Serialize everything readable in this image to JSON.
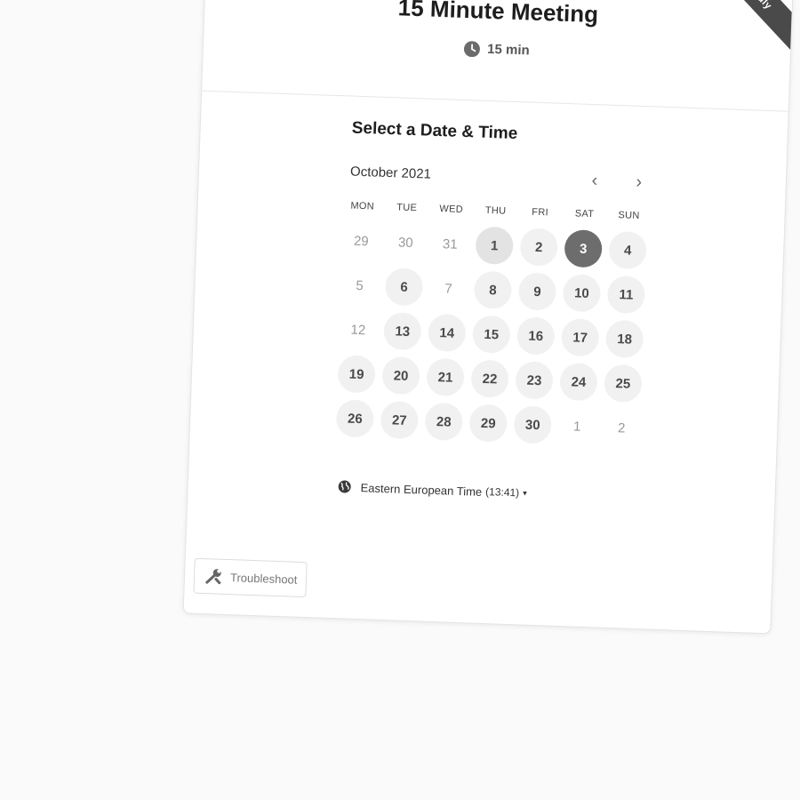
{
  "ribbon": {
    "text": "dly"
  },
  "header": {
    "title": "15 Minute Meeting",
    "duration": "15 min"
  },
  "calendar": {
    "section_title": "Select a Date & Time",
    "month": "October 2021",
    "prev_label": "‹",
    "next_label": "›",
    "days_of_week": [
      "MON",
      "TUE",
      "WED",
      "THU",
      "FRI",
      "SAT",
      "SUN"
    ],
    "weeks": [
      [
        {
          "day": "29",
          "state": "outside"
        },
        {
          "day": "30",
          "state": "outside"
        },
        {
          "day": "31",
          "state": "outside"
        },
        {
          "day": "1",
          "state": "today"
        },
        {
          "day": "2",
          "state": "available"
        },
        {
          "day": "3",
          "state": "selected"
        },
        {
          "day": "4",
          "state": "available"
        }
      ],
      [
        {
          "day": "5",
          "state": "unavailable"
        },
        {
          "day": "6",
          "state": "available"
        },
        {
          "day": "7",
          "state": "unavailable"
        },
        {
          "day": "8",
          "state": "available"
        },
        {
          "day": "9",
          "state": "available"
        },
        {
          "day": "10",
          "state": "available"
        },
        {
          "day": "11",
          "state": "available"
        }
      ],
      [
        {
          "day": "12",
          "state": "unavailable"
        },
        {
          "day": "13",
          "state": "available"
        },
        {
          "day": "14",
          "state": "available"
        },
        {
          "day": "15",
          "state": "available"
        },
        {
          "day": "16",
          "state": "available"
        },
        {
          "day": "17",
          "state": "available"
        },
        {
          "day": "18",
          "state": "available"
        }
      ],
      [
        {
          "day": "19",
          "state": "available"
        },
        {
          "day": "20",
          "state": "available"
        },
        {
          "day": "21",
          "state": "available"
        },
        {
          "day": "22",
          "state": "available"
        },
        {
          "day": "23",
          "state": "available"
        },
        {
          "day": "24",
          "state": "available"
        },
        {
          "day": "25",
          "state": "available"
        }
      ],
      [
        {
          "day": "26",
          "state": "available"
        },
        {
          "day": "27",
          "state": "available"
        },
        {
          "day": "28",
          "state": "available"
        },
        {
          "day": "29",
          "state": "available"
        },
        {
          "day": "30",
          "state": "available"
        },
        {
          "day": "1",
          "state": "outside"
        },
        {
          "day": "2",
          "state": "outside"
        }
      ]
    ]
  },
  "timezone": {
    "name": "Eastern European Time",
    "time": "(13:41)",
    "caret": "▾"
  },
  "troubleshoot": {
    "label": "Troubleshoot"
  },
  "icons": {
    "clock": "clock-icon",
    "globe": "globe-icon",
    "wrench": "wrench-icon",
    "caret": "caret-down-icon"
  },
  "colors": {
    "selected_day": "#6d6d6d",
    "available_day": "#f1f1f1",
    "ribbon": "#4a4a4a"
  }
}
